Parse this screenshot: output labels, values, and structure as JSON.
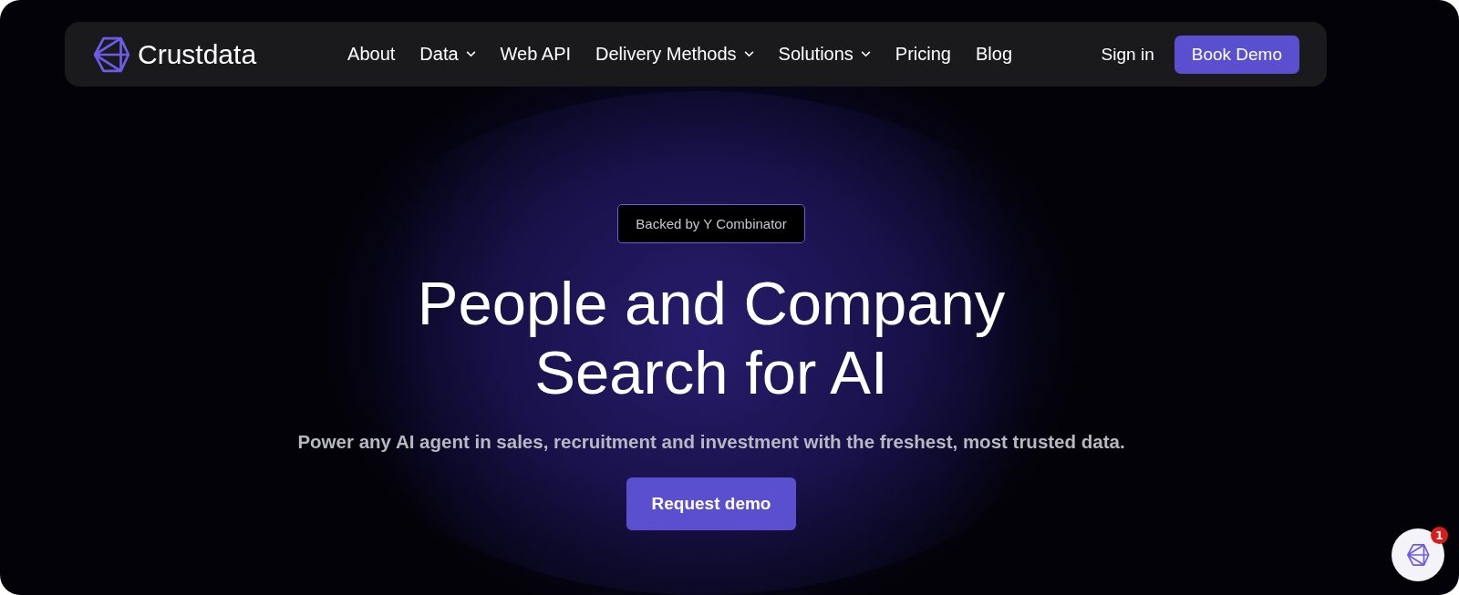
{
  "brand": {
    "name": "Crustdata"
  },
  "nav": {
    "items": [
      {
        "label": "About",
        "dropdown": false
      },
      {
        "label": "Data",
        "dropdown": true
      },
      {
        "label": "Web API",
        "dropdown": false
      },
      {
        "label": "Delivery Methods",
        "dropdown": true
      },
      {
        "label": "Solutions",
        "dropdown": true
      },
      {
        "label": "Pricing",
        "dropdown": false
      },
      {
        "label": "Blog",
        "dropdown": false
      }
    ],
    "sign_in": "Sign in",
    "cta": "Book Demo"
  },
  "hero": {
    "badge": "Backed by Y Combinator",
    "headline_lines": [
      "People and Company",
      "Search for AI"
    ],
    "subtitle": "Power any AI agent in sales, recruitment and investment with the freshest, most trusted data.",
    "button": "Request demo"
  },
  "chat": {
    "unread": "1"
  }
}
